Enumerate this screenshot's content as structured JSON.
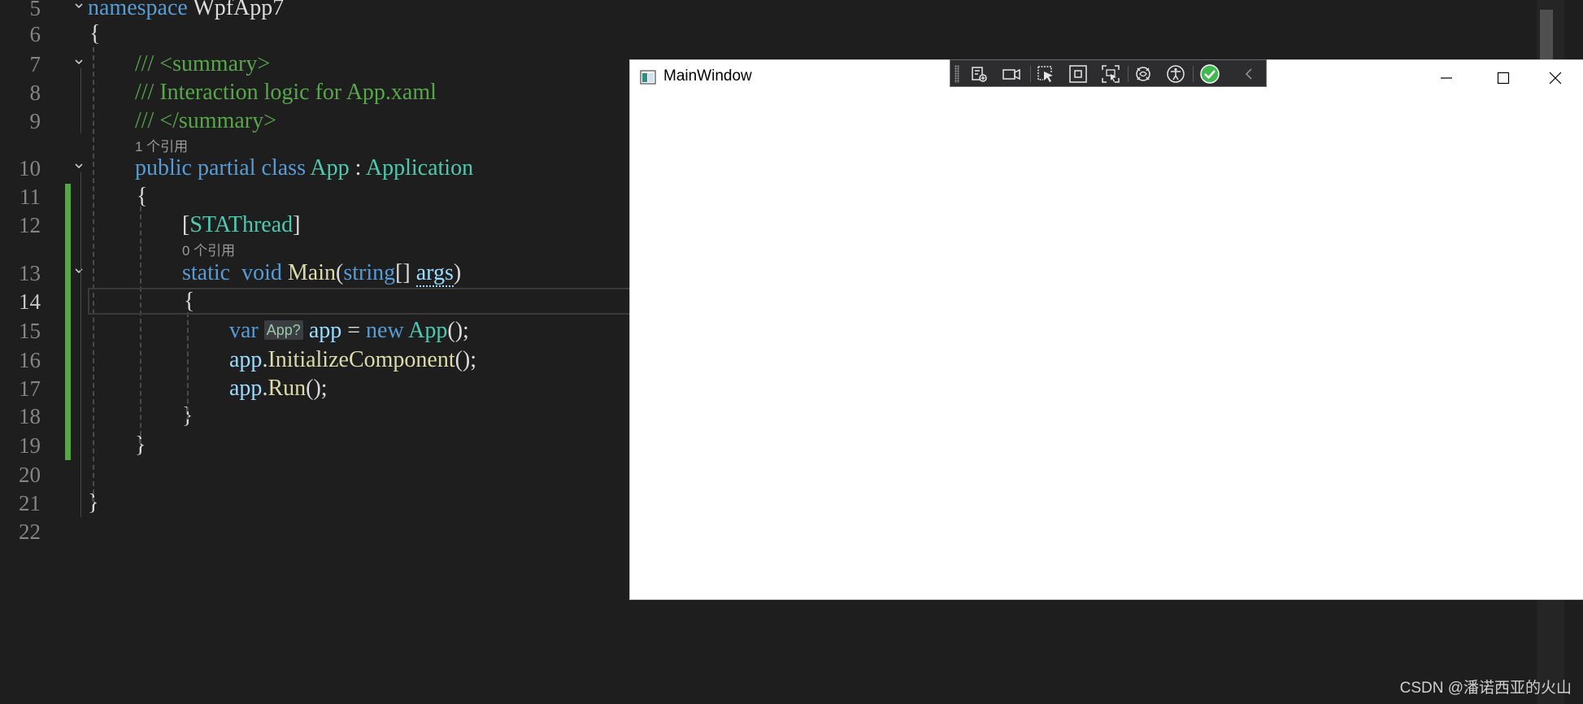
{
  "editor": {
    "lines": [
      {
        "num": "5",
        "code": [
          {
            "t": "namespace ",
            "c": "kw"
          },
          {
            "t": "WpfApp7",
            "c": ""
          }
        ]
      },
      {
        "num": "6",
        "code": [
          {
            "t": "{",
            "c": ""
          }
        ]
      },
      {
        "num": "7",
        "code": [
          {
            "t": "/// <summary>",
            "c": "cm"
          }
        ]
      },
      {
        "num": "8",
        "code": [
          {
            "t": "/// Interaction logic for App.xaml",
            "c": "cm"
          }
        ]
      },
      {
        "num": "9",
        "code": [
          {
            "t": "/// </summary>",
            "c": "cm"
          }
        ]
      },
      {
        "num": "10",
        "code": [
          {
            "t": "public ",
            "c": "kw"
          },
          {
            "t": "partial ",
            "c": "kw"
          },
          {
            "t": "class ",
            "c": "kw"
          },
          {
            "t": "App",
            "c": "cls"
          },
          {
            "t": " : ",
            "c": ""
          },
          {
            "t": "Application",
            "c": "cls"
          }
        ]
      },
      {
        "num": "11",
        "code": [
          {
            "t": "{",
            "c": ""
          }
        ]
      },
      {
        "num": "12",
        "code": [
          {
            "t": "[",
            "c": ""
          },
          {
            "t": "STAThread",
            "c": "cls"
          },
          {
            "t": "]",
            "c": ""
          }
        ]
      },
      {
        "num": "13",
        "code": [
          {
            "t": "static ",
            "c": "kw"
          },
          {
            "t": " void ",
            "c": "kw"
          },
          {
            "t": "Main",
            "c": "fn"
          },
          {
            "t": "(",
            "c": ""
          },
          {
            "t": "string",
            "c": "kw"
          },
          {
            "t": "[] ",
            "c": ""
          },
          {
            "t": "args",
            "c": "param"
          },
          {
            "t": ")",
            "c": ""
          }
        ]
      },
      {
        "num": "14",
        "code": [
          {
            "t": "{",
            "c": ""
          }
        ]
      },
      {
        "num": "15",
        "code": [
          {
            "t": "var ",
            "c": "kw"
          },
          {
            "t": "App?",
            "c": "hint"
          },
          {
            "t": " app",
            "c": "var"
          },
          {
            "t": " = ",
            "c": ""
          },
          {
            "t": "new ",
            "c": "kw"
          },
          {
            "t": "App",
            "c": "cls"
          },
          {
            "t": "();",
            "c": ""
          }
        ]
      },
      {
        "num": "16",
        "code": [
          {
            "t": "app",
            "c": "var"
          },
          {
            "t": ".",
            "c": ""
          },
          {
            "t": "InitializeComponent",
            "c": "fn"
          },
          {
            "t": "();",
            "c": ""
          }
        ]
      },
      {
        "num": "17",
        "code": [
          {
            "t": "app",
            "c": "var"
          },
          {
            "t": ".",
            "c": ""
          },
          {
            "t": "Run",
            "c": "fn"
          },
          {
            "t": "();",
            "c": ""
          }
        ]
      },
      {
        "num": "18",
        "code": [
          {
            "t": "}",
            "c": ""
          }
        ]
      },
      {
        "num": "19",
        "code": [
          {
            "t": "}",
            "c": ""
          }
        ]
      },
      {
        "num": "20",
        "code": []
      },
      {
        "num": "21",
        "code": [
          {
            "t": "}",
            "c": ""
          }
        ]
      },
      {
        "num": "22",
        "code": []
      }
    ],
    "codelens": {
      "class_refs": "1 个引用",
      "main_refs": "0 个引用"
    }
  },
  "app_window": {
    "title": "MainWindow",
    "icon": "window-app-icon",
    "controls": [
      "minimize-icon",
      "maximize-icon",
      "close-icon"
    ]
  },
  "debug_toolbar": {
    "buttons": [
      "go-to-live-visual-tree-icon",
      "record-icon",
      "select-element-icon",
      "display-layout-adorners-icon",
      "track-focus-icon",
      "hot-reload-icon",
      "accessibility-icon",
      "binding-failures-ok-icon",
      "collapse-toolbar-icon"
    ],
    "colors": {
      "background": "#2d2d30",
      "check": "#3fb950"
    }
  },
  "watermark": "CSDN @潘诺西亚的火山"
}
